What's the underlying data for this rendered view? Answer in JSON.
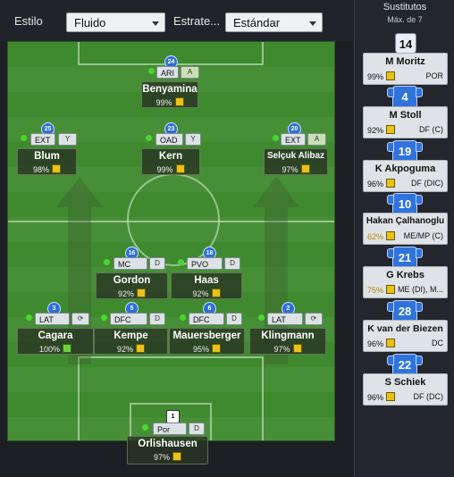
{
  "controls": {
    "style_label": "Estilo",
    "style_value": "Fluido",
    "strategy_label": "Estrate...",
    "strategy_value": "Estándar"
  },
  "players": [
    {
      "id": "benyamina",
      "number": "24",
      "role": "ARI",
      "duty": "A",
      "name": "Benyamina",
      "condition": "99%",
      "morale": "yellow"
    },
    {
      "id": "blum",
      "number": "25",
      "role": "EXT",
      "duty": "Y",
      "name": "Blum",
      "condition": "98%",
      "morale": "yellow"
    },
    {
      "id": "kern",
      "number": "23",
      "role": "OAD",
      "duty": "Y",
      "name": "Kern",
      "condition": "99%",
      "morale": "yellow"
    },
    {
      "id": "alibaz",
      "number": "20",
      "role": "EXT",
      "duty": "A",
      "name": "Selçuk Alibaz",
      "condition": "97%",
      "morale": "yellow"
    },
    {
      "id": "gordon",
      "number": "16",
      "role": "MC",
      "duty": "D",
      "name": "Gordon",
      "condition": "92%",
      "morale": "yellow"
    },
    {
      "id": "haas",
      "number": "18",
      "role": "PVO",
      "duty": "D",
      "name": "Haas",
      "condition": "92%",
      "morale": "yellow"
    },
    {
      "id": "cagara",
      "number": "3",
      "role": "LAT",
      "duty": "⟳",
      "name": "Cagara",
      "condition": "100%",
      "morale": "green"
    },
    {
      "id": "kempe",
      "number": "5",
      "role": "DFC",
      "duty": "D",
      "name": "Kempe",
      "condition": "92%",
      "morale": "yellow"
    },
    {
      "id": "mauersberger",
      "number": "6",
      "role": "DFC",
      "duty": "D",
      "name": "Mauersberger",
      "condition": "95%",
      "morale": "yellow"
    },
    {
      "id": "klingmann",
      "number": "2",
      "role": "LAT",
      "duty": "⟳",
      "name": "Klingmann",
      "condition": "97%",
      "morale": "yellow"
    },
    {
      "id": "orlishausen",
      "number": "1",
      "role": "Por",
      "duty": "D",
      "name": "Orlishausen",
      "condition": "97%",
      "morale": "yellow"
    }
  ],
  "subs": {
    "title": "Sustitutos",
    "max": "Máx. de 7",
    "badge": "14",
    "items": [
      {
        "name": "M Moritz",
        "number": "",
        "condition": "99%",
        "position": "POR",
        "warn": false
      },
      {
        "name": "M Stoll",
        "number": "4",
        "condition": "92%",
        "position": "DF (C)",
        "warn": false
      },
      {
        "name": "K Akpoguma",
        "number": "19",
        "condition": "96%",
        "position": "DF (DIC)",
        "warn": false
      },
      {
        "name": "Hakan Çalhanoglu",
        "number": "10",
        "condition": "62%",
        "position": "ME/MP (C)",
        "warn": true
      },
      {
        "name": "G Krebs",
        "number": "21",
        "condition": "75%",
        "position": "ME (DI), M...",
        "warn": true
      },
      {
        "name": "K van der Biezen",
        "number": "28",
        "condition": "96%",
        "position": "DC",
        "warn": false
      },
      {
        "name": "S Schiek",
        "number": "22",
        "condition": "96%",
        "position": "DF (DC)",
        "warn": false
      }
    ]
  }
}
